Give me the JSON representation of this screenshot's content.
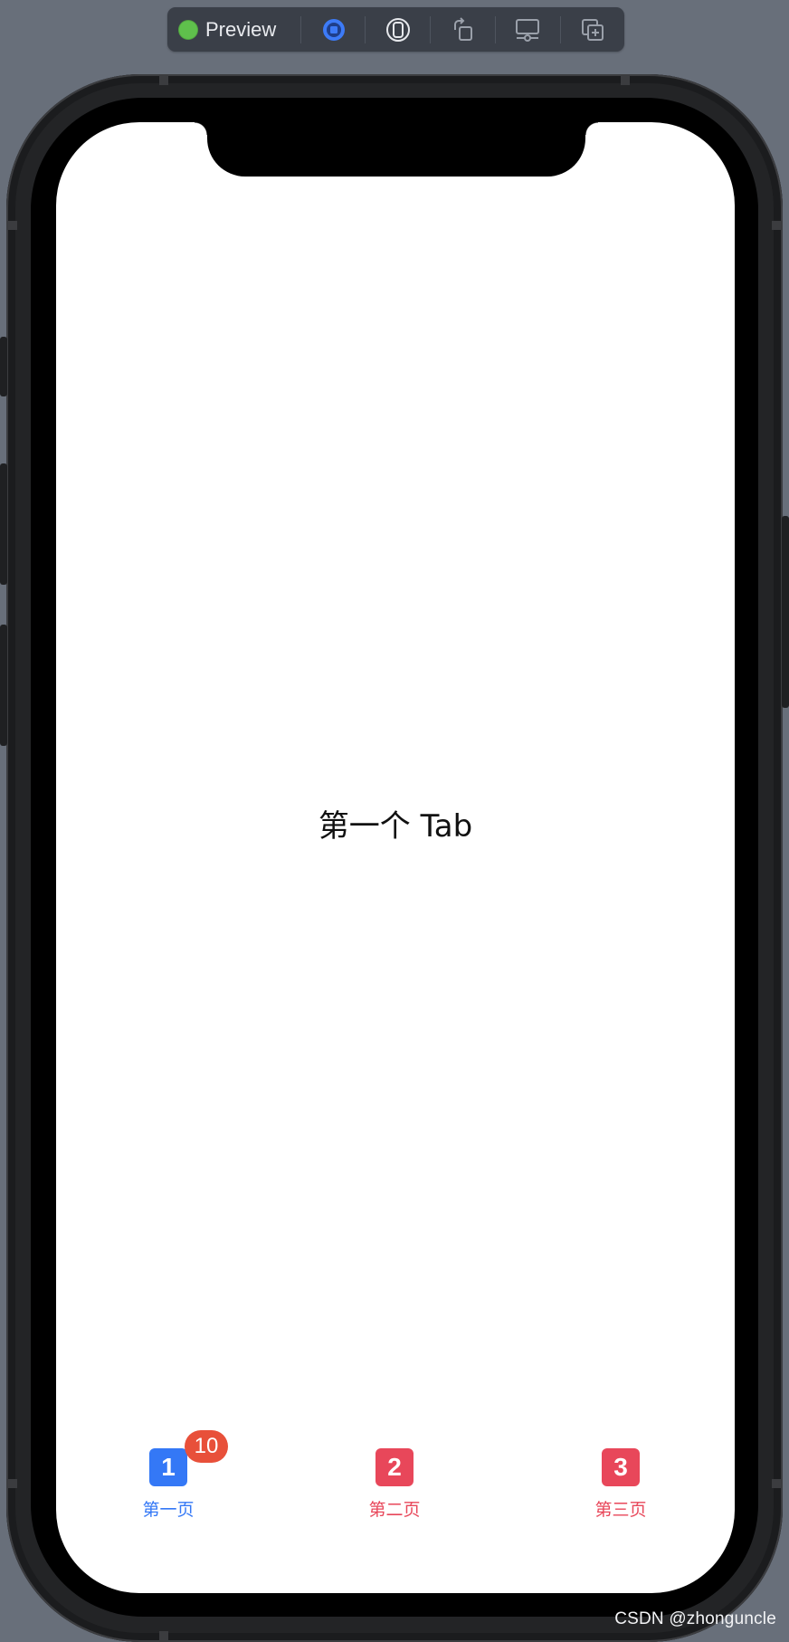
{
  "toolbar": {
    "preview_label": "Preview",
    "live_indicator_color": "#5fc04c",
    "buttons": [
      {
        "name": "live-preview-icon",
        "color": "#3d7bf7"
      },
      {
        "name": "device-settings-icon",
        "color": "#e6e8ec"
      },
      {
        "name": "rotate-device-icon",
        "color": "#9aa0aa"
      },
      {
        "name": "display-settings-icon",
        "color": "#9aa0aa"
      },
      {
        "name": "duplicate-preview-icon",
        "color": "#9aa0aa"
      }
    ]
  },
  "screen": {
    "content_text": "第一个 Tab"
  },
  "tabbar": {
    "tabs": [
      {
        "icon_text": "1",
        "label": "第一页",
        "color": "#3478f6",
        "selected": true,
        "badge": "10"
      },
      {
        "icon_text": "2",
        "label": "第二页",
        "color": "#e8475a",
        "selected": false
      },
      {
        "icon_text": "3",
        "label": "第三页",
        "color": "#e8475a",
        "selected": false
      }
    ],
    "badge_color": "#e8503a"
  },
  "watermark": "CSDN @zhonguncle"
}
